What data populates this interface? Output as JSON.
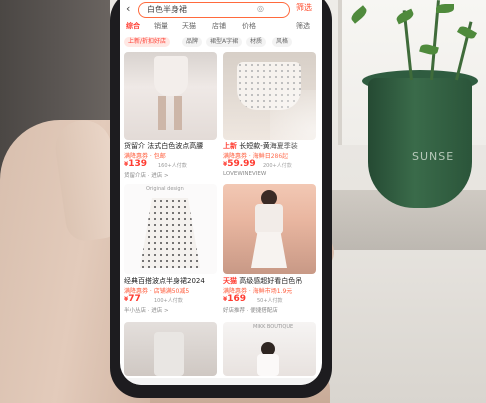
{
  "search": {
    "query": "白色半身裙",
    "button": "筛选"
  },
  "tabs": [
    "综合",
    "销量",
    "天猫",
    "店铺",
    "价格",
    "筛选"
  ],
  "chips": [
    "包邮",
    "品牌",
    "裙型A字裙",
    "材质",
    "风格"
  ],
  "promo_badge": "上新/折扣好店",
  "products": [
    {
      "title": "货留介 法式白色波点高腰",
      "sub": "满降惠券 · 包邮",
      "price": "139",
      "meta": "160+人付款",
      "shop": "货留介店 · 进店 >"
    },
    {
      "title_tag": "上新",
      "title": "长短款-黄海夏季装",
      "sub": "满降惠券 · 海鲜日286起",
      "price": "59.99",
      "meta": "200+人付款",
      "shop": "LOVEWINEVIEW"
    },
    {
      "title": "经典百搭波点半身裙2024",
      "sub": "满降惠券 · 店铺满50减5",
      "price": "77",
      "meta": "100+人付款",
      "shop": "半小丛店 · 进店 >"
    },
    {
      "title_tag": "天猫",
      "title": "高级感超好看白色吊",
      "sub": "满降惠券 · 海鲜市场1.9元",
      "price": "169",
      "meta": "50+人付款",
      "shop": "好店推荐 · 便捷搭配店"
    }
  ],
  "image_caption_left": "Original design",
  "image_caption_right": "MIKK BOUTIQUE",
  "pot_label": "SUNSE"
}
